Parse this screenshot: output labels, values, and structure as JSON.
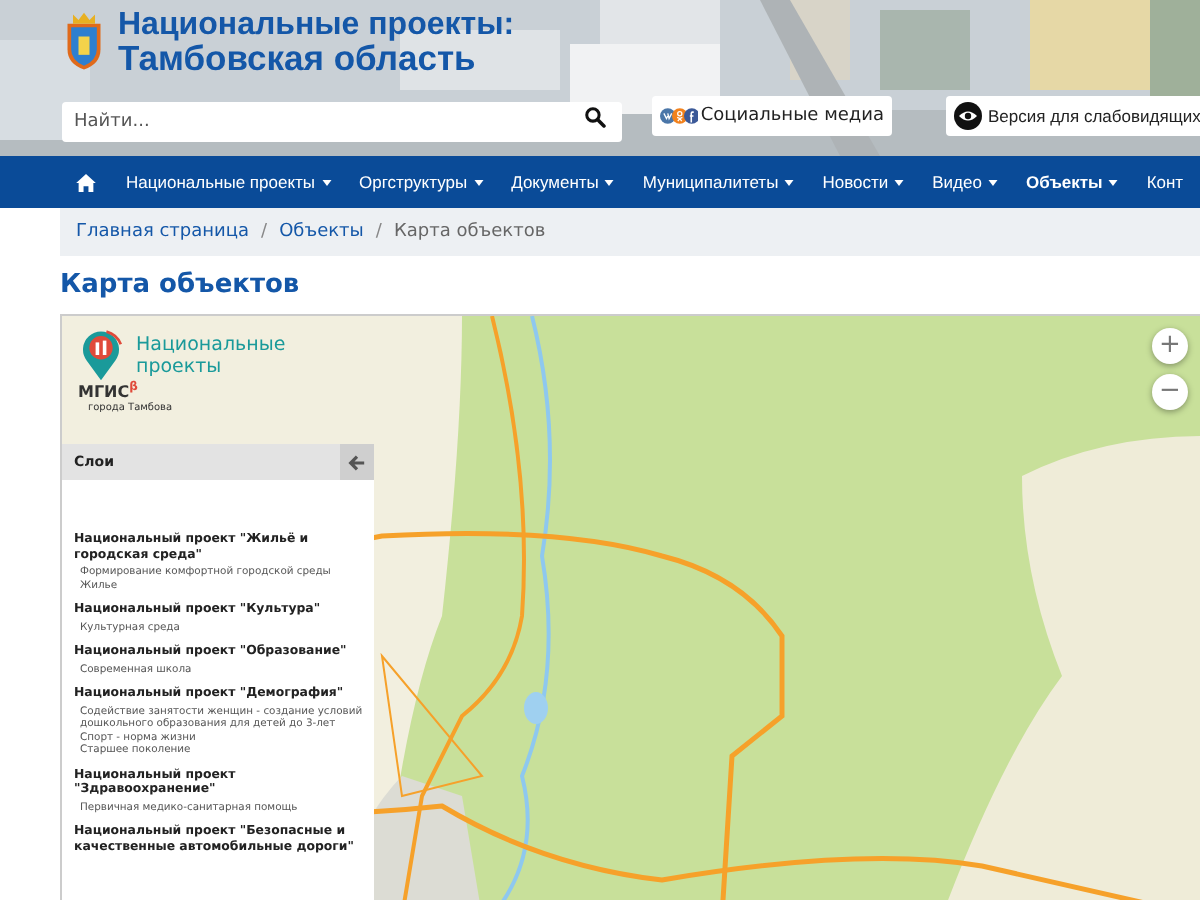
{
  "header": {
    "title_lines": [
      "Национальные проекты:",
      "Тамбовская область"
    ],
    "search": {
      "placeholder": "Найти..."
    },
    "social_button": "Социальные медиа",
    "accessibility_button": "Версия для слабовидящих"
  },
  "nav": [
    {
      "kind": "home",
      "selected": false
    },
    {
      "kind": "link",
      "label": "Национальные проекты",
      "dropdown": true,
      "selected": false
    },
    {
      "kind": "link",
      "label": "Оргструктуры",
      "dropdown": true,
      "selected": false
    },
    {
      "kind": "link",
      "label": "Документы",
      "dropdown": true,
      "selected": false
    },
    {
      "kind": "link",
      "label": "Муниципалитеты",
      "dropdown": true,
      "selected": false
    },
    {
      "kind": "link",
      "label": "Новости",
      "dropdown": true,
      "selected": false
    },
    {
      "kind": "link",
      "label": "Видео",
      "dropdown": true,
      "selected": false
    },
    {
      "kind": "link",
      "label": "Объекты",
      "dropdown": true,
      "selected": true
    },
    {
      "kind": "link",
      "label": "Конт",
      "dropdown": false,
      "selected": false
    }
  ],
  "breadcrumbs": [
    "Главная страница",
    "Объекты",
    "Карта объектов"
  ],
  "breadcrumb_separator": "/",
  "page_title": "Карта объектов",
  "map": {
    "brand": {
      "name": "Национальные проекты",
      "logo_text": "МГИС",
      "logo_mark": "β",
      "subtitle": "города Тамбова"
    },
    "layers_title": "Слои",
    "groups": [
      {
        "title": "Национальный проект \"Жильё и городская среда\"",
        "items": [
          "Формирование комфортной городской среды",
          "Жилье"
        ]
      },
      {
        "title": "Национальный проект \"Культура\"",
        "items": [
          "Культурная среда"
        ]
      },
      {
        "title": "Национальный проект \"Образование\"",
        "items": [
          "Современная школа"
        ]
      },
      {
        "title": "Национальный проект \"Демография\"",
        "items": [
          "Содействие занятости женщин - создание условий дошкольного образования для детей до 3-лет",
          "Спорт - норма жизни",
          "Старшее поколение"
        ]
      },
      {
        "title": "Национальный проект \"Здравоохранение\"",
        "items": [
          "Первичная медико-санитарная помощь"
        ]
      },
      {
        "title": "Национальный проект \"Безопасные и качественные автомобильные дороги\""
      }
    ],
    "zoom_buttons": [
      "+",
      "−"
    ]
  }
}
